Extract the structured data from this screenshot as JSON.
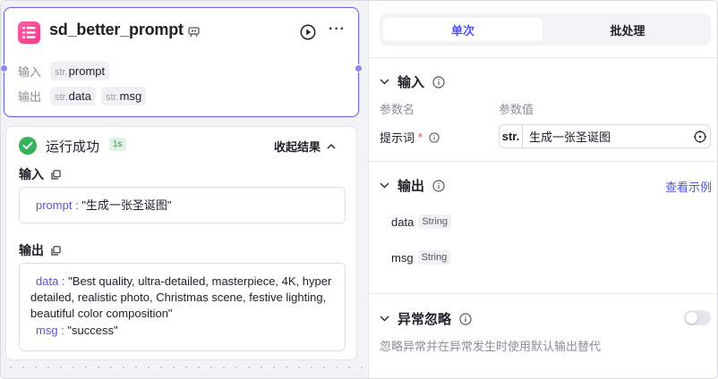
{
  "node": {
    "title": "sd_better_prompt",
    "input_label": "输入",
    "output_label": "输出",
    "type_prefix": "str.",
    "inputs": [
      "prompt"
    ],
    "outputs": [
      "data",
      "msg"
    ]
  },
  "result": {
    "status": "运行成功",
    "duration": "1s",
    "collapse_label": "收起结果",
    "input_title": "输入",
    "output_title": "输出",
    "input_key": "prompt",
    "input_value": "\"生成一张圣诞图\"",
    "output_data_key": "data",
    "output_data_value": "\"Best quality, ultra-detailed, masterpiece, 4K, hyper detailed, realistic photo, Christmas scene, festive lighting, beautiful color composition\"",
    "output_msg_key": "msg",
    "output_msg_value": "\"success\"",
    "separator": " : "
  },
  "panel": {
    "tabs": [
      "单次",
      "批处理"
    ],
    "active_tab": "单次",
    "input_section": "输入",
    "col_name": "参数名",
    "col_value": "参数值",
    "param_label": "提示词",
    "param_required_mark": "*",
    "param_type": "str.",
    "param_value": "生成一张圣诞图",
    "output_section": "输出",
    "view_example": "查看示例",
    "outputs": [
      {
        "name": "data",
        "type": "String"
      },
      {
        "name": "msg",
        "type": "String"
      }
    ],
    "ignore_section": "异常忽略",
    "ignore_desc": "忽略异常并在异常发生时使用默认输出替代",
    "ignore_enabled": false
  },
  "colors": {
    "accent": "#4d53e8",
    "node_border": "#6b63e6",
    "success": "#33b35a",
    "node_icon": "#f03a8a"
  }
}
